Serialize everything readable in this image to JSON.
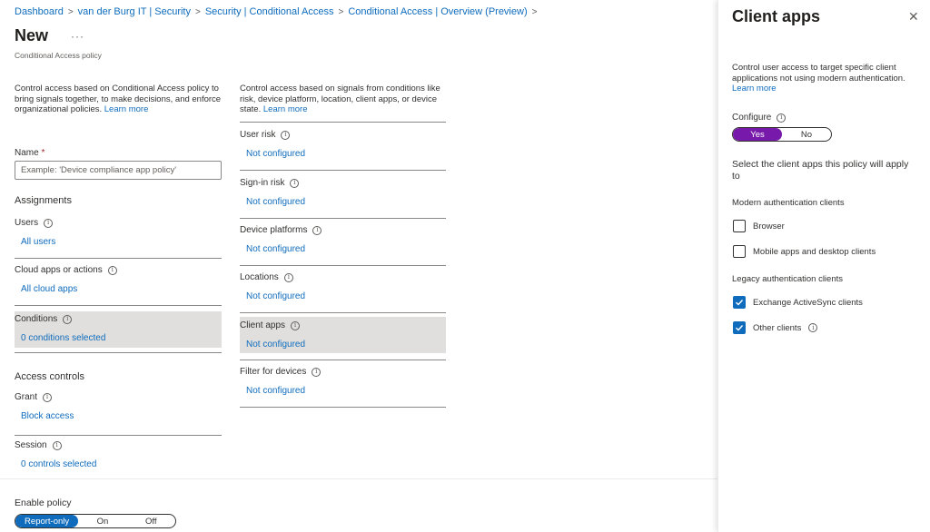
{
  "breadcrumb": [
    "Dashboard",
    "van der Burg IT | Security",
    "Security | Conditional Access",
    "Conditional Access | Overview (Preview)"
  ],
  "page": {
    "title": "New",
    "more": "···",
    "subtitle": "Conditional Access policy"
  },
  "left": {
    "description": "Control access based on Conditional Access policy to bring signals together, to make decisions, and enforce organizational policies.",
    "learn_more": "Learn more",
    "name_label": "Name",
    "name_required": "*",
    "name_placeholder": "Example: 'Device compliance app policy'",
    "assignments": "Assignments",
    "users_label": "Users",
    "users_value": "All users",
    "cloud_label": "Cloud apps or actions",
    "cloud_value": "All cloud apps",
    "conditions_label": "Conditions",
    "conditions_value": "0 conditions selected",
    "access_controls": "Access controls",
    "grant_label": "Grant",
    "grant_value": "Block access",
    "session_label": "Session",
    "session_value": "0 controls selected"
  },
  "middle": {
    "description": "Control access based on signals from conditions like risk, device platform, location, client apps, or device state.",
    "learn_more": "Learn more",
    "items": [
      {
        "label": "User risk",
        "value": "Not configured"
      },
      {
        "label": "Sign-in risk",
        "value": "Not configured"
      },
      {
        "label": "Device platforms",
        "value": "Not configured"
      },
      {
        "label": "Locations",
        "value": "Not configured"
      },
      {
        "label": "Client apps",
        "value": "Not configured"
      },
      {
        "label": "Filter for devices",
        "value": "Not configured"
      }
    ]
  },
  "footer": {
    "enable_label": "Enable policy",
    "options": [
      "Report-only",
      "On",
      "Off"
    ],
    "selected": "Report-only"
  },
  "panel": {
    "title": "Client apps",
    "close": "✕",
    "description": "Control user access to target specific client applications not using modern authentication.",
    "learn_more": "Learn more",
    "configure_label": "Configure",
    "configure_options": [
      "Yes",
      "No"
    ],
    "configure_selected": "Yes",
    "select_text": "Select the client apps this policy will apply to",
    "modern_heading": "Modern authentication clients",
    "modern_items": [
      {
        "label": "Browser",
        "checked": false
      },
      {
        "label": "Mobile apps and desktop clients",
        "checked": false
      }
    ],
    "legacy_heading": "Legacy authentication clients",
    "legacy_items": [
      {
        "label": "Exchange ActiveSync clients",
        "checked": true
      },
      {
        "label": "Other clients",
        "checked": true
      }
    ]
  },
  "colors": {
    "link": "#0f6cbd",
    "highlight": "#e1dfdd",
    "toggle_on": "#0f6cbd",
    "configure_on": "#7719aa",
    "required": "#a4262c"
  },
  "icons": {
    "info": "info-circle-icon",
    "close": "close-icon",
    "breadcrumb_sep": "chevron-right-icon",
    "check": "checkmark-icon"
  }
}
